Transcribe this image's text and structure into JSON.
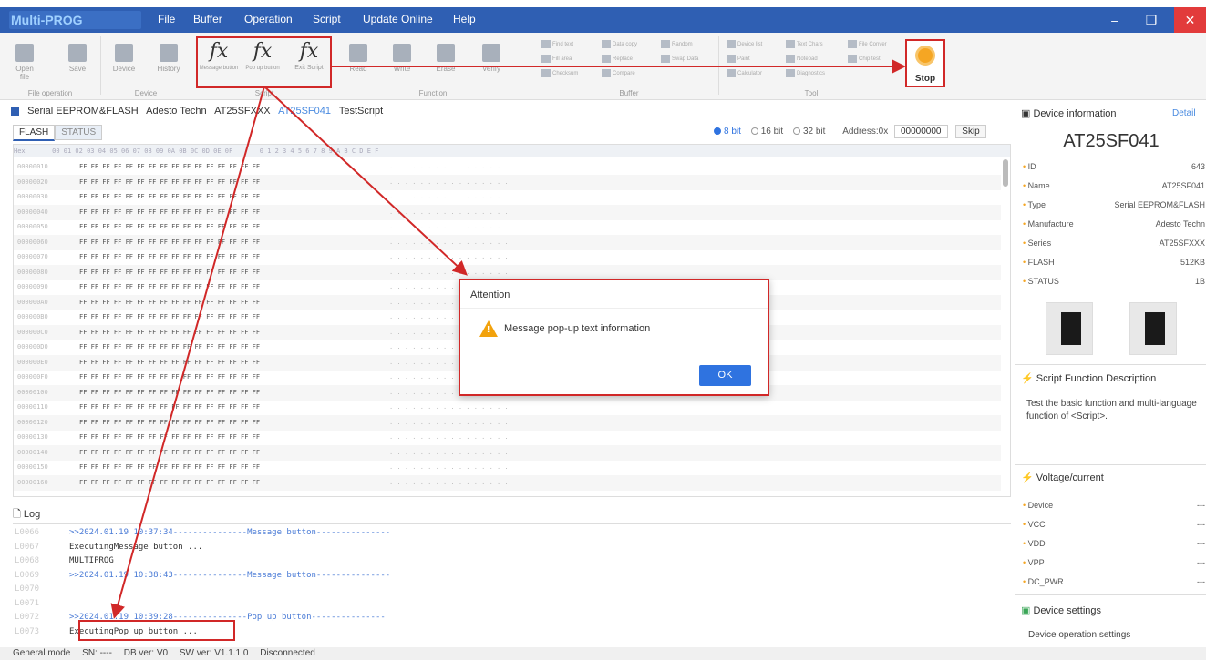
{
  "app": {
    "title": "Multi-PROG"
  },
  "menu": [
    "File",
    "Buffer",
    "Operation",
    "Script",
    "Update Online",
    "Help"
  ],
  "ribbon": {
    "file_group": {
      "label": "File operation",
      "buttons": [
        "Open file",
        "Save"
      ]
    },
    "device_group": {
      "label": "Device",
      "buttons": [
        "Device",
        "History"
      ]
    },
    "script_group": {
      "label": "Script",
      "buttons": [
        "Message button",
        "Pop up button",
        "Exit Script"
      ]
    },
    "function_group": {
      "label": "Function",
      "buttons": [
        "Read",
        "Write",
        "Erase",
        "Verify"
      ]
    },
    "buffer_group": {
      "label": "Buffer",
      "tools": [
        "Find text",
        "Data copy",
        "Random",
        "Fill area",
        "Replace",
        "Swap Data",
        "Checksum",
        "Compare"
      ]
    },
    "tool_group": {
      "label": "Tool",
      "tools": [
        "Device list",
        "Text Chars",
        "File Conver",
        "Paint",
        "Notepad",
        "Chip test",
        "Calculator",
        "Diagnostics"
      ]
    },
    "stop": {
      "label": "Stop"
    }
  },
  "breadcrumb": [
    "Serial EEPROM&FLASH",
    "Adesto Techn",
    "AT25SFXXX",
    "AT25SF041",
    "TestScript"
  ],
  "tabs": [
    "FLASH",
    "STATUS"
  ],
  "bit_options": [
    "8 bit",
    "16 bit",
    "32 bit"
  ],
  "address": {
    "label": "Address:0x",
    "value": "00000000",
    "skip_label": "Skip"
  },
  "hex": {
    "header": "Hex       00 01 02 03 04 05 06 07 08 09 0A 0B 0C 0D 0E 0F       0 1 2 3 4 5 6 7 8 9 A B C D E F",
    "rows": [
      {
        "addr": "00000010",
        "bytes": "FF FF FF FF FF FF FF FF FF FF FF FF FF FF FF FF",
        "ascii": ". . . . . . . . . . . . . . . ."
      },
      {
        "addr": "00000020",
        "bytes": "FF FF FF FF FF FF FF FF FF FF FF FF FF FF FF FF",
        "ascii": ". . . . . . . . . . . . . . . ."
      },
      {
        "addr": "00000030",
        "bytes": "FF FF FF FF FF FF FF FF FF FF FF FF FF FF FF FF",
        "ascii": ". . . . . . . . . . . . . . . ."
      },
      {
        "addr": "00000040",
        "bytes": "FF FF FF FF FF FF FF FF FF FF FF FF FF FF FF FF",
        "ascii": ". . . . . . . . . . . . . . . ."
      },
      {
        "addr": "00000050",
        "bytes": "FF FF FF FF FF FF FF FF FF FF FF FF FF FF FF FF",
        "ascii": ". . . . . . . . . . . . . . . ."
      },
      {
        "addr": "00000060",
        "bytes": "FF FF FF FF FF FF FF FF FF FF FF FF FF FF FF FF",
        "ascii": ". . . . . . . . . . . . . . . ."
      },
      {
        "addr": "00000070",
        "bytes": "FF FF FF FF FF FF FF FF FF FF FF FF FF FF FF FF",
        "ascii": ". . . . . . . . . . . . . . . ."
      },
      {
        "addr": "00000080",
        "bytes": "FF FF FF FF FF FF FF FF FF FF FF FF FF FF FF FF",
        "ascii": ". . . . . . . . . . . . . . . ."
      },
      {
        "addr": "00000090",
        "bytes": "FF FF FF FF FF FF FF FF FF FF FF FF FF FF FF FF",
        "ascii": ". . . . . . . . . . . . . . . ."
      },
      {
        "addr": "000000A0",
        "bytes": "FF FF FF FF FF FF FF FF FF FF FF FF FF FF FF FF",
        "ascii": ". . . . . . . . . . . . . . . ."
      },
      {
        "addr": "000000B0",
        "bytes": "FF FF FF FF FF FF FF FF FF FF FF FF FF FF FF FF",
        "ascii": ". . . . . . . . . . . . . . . ."
      },
      {
        "addr": "000000C0",
        "bytes": "FF FF FF FF FF FF FF FF FF FF FF FF FF FF FF FF",
        "ascii": ". . . . . . . . . . . . . . . ."
      },
      {
        "addr": "000000D0",
        "bytes": "FF FF FF FF FF FF FF FF FF FF FF FF FF FF FF FF",
        "ascii": ". . . . . . . . . . . . . . . ."
      },
      {
        "addr": "000000E0",
        "bytes": "FF FF FF FF FF FF FF FF FF FF FF FF FF FF FF FF",
        "ascii": ". . . . . . . . . . . . . . . ."
      },
      {
        "addr": "000000F0",
        "bytes": "FF FF FF FF FF FF FF FF FF FF FF FF FF FF FF FF",
        "ascii": ". . . . . . . . . . . . . . . ."
      },
      {
        "addr": "00000100",
        "bytes": "FF FF FF FF FF FF FF FF FF FF FF FF FF FF FF FF",
        "ascii": ". . . . . . . . . . . . . . . ."
      },
      {
        "addr": "00000110",
        "bytes": "FF FF FF FF FF FF FF FF FF FF FF FF FF FF FF FF",
        "ascii": ". . . . . . . . . . . . . . . ."
      },
      {
        "addr": "00000120",
        "bytes": "FF FF FF FF FF FF FF FF FF FF FF FF FF FF FF FF",
        "ascii": ". . . . . . . . . . . . . . . ."
      },
      {
        "addr": "00000130",
        "bytes": "FF FF FF FF FF FF FF FF FF FF FF FF FF FF FF FF",
        "ascii": ". . . . . . . . . . . . . . . ."
      },
      {
        "addr": "00000140",
        "bytes": "FF FF FF FF FF FF FF FF FF FF FF FF FF FF FF FF",
        "ascii": ". . . . . . . . . . . . . . . ."
      },
      {
        "addr": "00000150",
        "bytes": "FF FF FF FF FF FF FF FF FF FF FF FF FF FF FF FF",
        "ascii": ". . . . . . . . . . . . . . . ."
      },
      {
        "addr": "00000160",
        "bytes": "FF FF FF FF FF FF FF FF FF FF FF FF FF FF FF FF",
        "ascii": ". . . . . . . . . . . . . . . ."
      }
    ]
  },
  "dialog": {
    "title": "Attention",
    "message": "Message pop-up text information",
    "ok_label": "OK"
  },
  "log": {
    "title": "Log",
    "lines": [
      {
        "n": "L0066",
        "text": ">>2024.01.19 10:37:34---------------Message button---------------",
        "style": "blue"
      },
      {
        "n": "L0067",
        "text": "ExecutingMessage button ...",
        "style": "plain"
      },
      {
        "n": "L0068",
        "text": "MULTIPROG",
        "style": "plain"
      },
      {
        "n": "L0069",
        "text": ">>2024.01.19 10:38:43---------------Message button---------------",
        "style": "blue"
      },
      {
        "n": "L0070",
        "text": "",
        "style": "plain"
      },
      {
        "n": "L0071",
        "text": "",
        "style": "plain"
      },
      {
        "n": "L0072",
        "text": ">>2024.01.19 10:39:28---------------Pop up button---------------",
        "style": "blue"
      },
      {
        "n": "L0073",
        "text": "ExecutingPop up button ...",
        "style": "plain"
      }
    ]
  },
  "status_bar": [
    "General mode",
    "SN: ----",
    "DB ver: V0",
    "SW ver: V1.1.1.0",
    "Disconnected"
  ],
  "right_panel": {
    "device_info": {
      "title": "Device information",
      "detail": "Detail",
      "name": "AT25SF041",
      "fields": [
        {
          "k": "ID",
          "v": "643"
        },
        {
          "k": "Name",
          "v": "AT25SF041"
        },
        {
          "k": "Type",
          "v": "Serial EEPROM&FLASH"
        },
        {
          "k": "Manufacture",
          "v": "Adesto Techn"
        },
        {
          "k": "Series",
          "v": "AT25SFXXX"
        },
        {
          "k": "FLASH",
          "v": "512KB"
        },
        {
          "k": "STATUS",
          "v": "1B"
        }
      ]
    },
    "script_desc": {
      "title": "Script Function Description",
      "text": "Test the basic function and multi-language function of <Script>."
    },
    "voltage": {
      "title": "Voltage/current",
      "fields": [
        {
          "k": "Device",
          "v": "---"
        },
        {
          "k": "VCC",
          "v": "---"
        },
        {
          "k": "VDD",
          "v": "---"
        },
        {
          "k": "VPP",
          "v": "---"
        },
        {
          "k": "DC_PWR",
          "v": "---"
        }
      ]
    },
    "settings": {
      "title": "Device settings",
      "sub": "Device operation settings"
    }
  },
  "colors": {
    "accent": "#2f5fb3",
    "highlight": "#d12828",
    "ok": "#2f73e0",
    "warn": "#f2a20c",
    "stop": "#f5a623"
  }
}
